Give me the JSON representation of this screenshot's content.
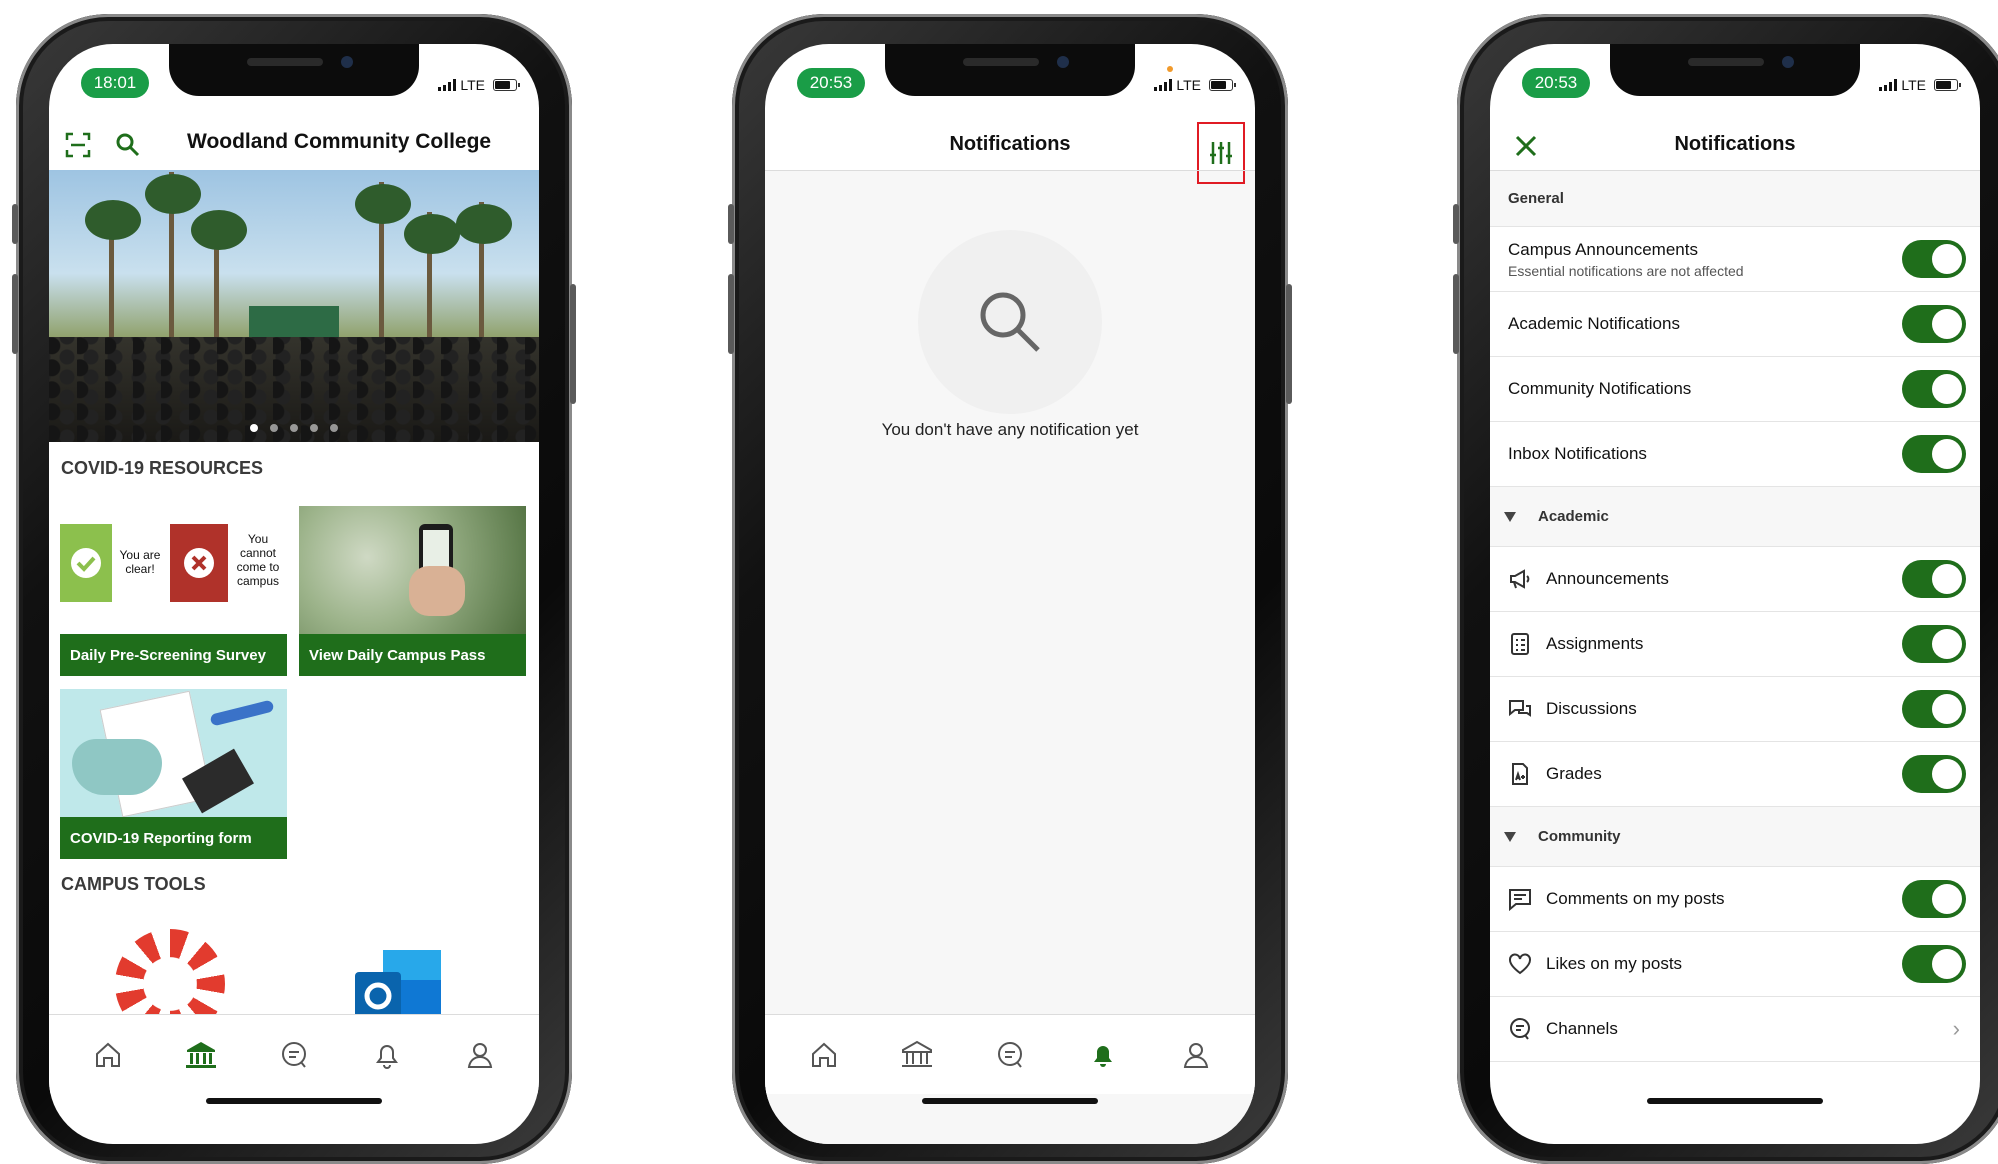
{
  "accent_color": "#1f6e1b",
  "status_color": "#1a9d47",
  "phones": [
    {
      "time": "18:01",
      "network": "LTE",
      "header": {
        "title": "Woodland Community College",
        "icons": [
          "scan-icon",
          "search-icon"
        ]
      },
      "banner": {
        "slides": 5,
        "active_slide": 1
      },
      "sections": {
        "covid_title": "COVID-19 RESOURCES",
        "tools_title": "CAMPUS TOOLS"
      },
      "cards": [
        {
          "label": "Daily Pre-Screening Survey",
          "clear_text": "You are clear!",
          "cannot_text": "You cannot come to campus"
        },
        {
          "label": "View Daily Campus Pass"
        },
        {
          "label": "COVID-19 Reporting form"
        }
      ],
      "tools": [
        "canvas-logo",
        "outlook-logo"
      ],
      "tabs": [
        "home-icon",
        "campus-icon",
        "messages-icon",
        "bell-icon",
        "profile-icon"
      ],
      "active_tab": "campus-icon"
    },
    {
      "time": "20:53",
      "network": "LTE",
      "header": {
        "title": "Notifications"
      },
      "empty_message": "You don't have any notification yet",
      "active_tab": "bell-icon"
    },
    {
      "time": "20:53",
      "network": "LTE",
      "header": {
        "title": "Notifications"
      },
      "general_label": "General",
      "rows_general": [
        {
          "label": "Campus Announcements",
          "sub": "Essential notifications are not affected",
          "on": true
        },
        {
          "label": "Academic Notifications",
          "on": true
        },
        {
          "label": "Community Notifications",
          "on": true
        },
        {
          "label": "Inbox Notifications",
          "on": true
        }
      ],
      "academic_label": "Academic",
      "rows_academic": [
        {
          "label": "Announcements",
          "icon": "megaphone-icon",
          "on": true
        },
        {
          "label": "Assignments",
          "icon": "checklist-icon",
          "on": true
        },
        {
          "label": "Discussions",
          "icon": "chat-bubbles-icon",
          "on": true
        },
        {
          "label": "Grades",
          "icon": "grades-icon",
          "on": true
        }
      ],
      "community_label": "Community",
      "rows_community": [
        {
          "label": "Comments on my posts",
          "icon": "comment-icon",
          "on": true
        },
        {
          "label": "Likes on my posts",
          "icon": "heart-icon",
          "on": true
        },
        {
          "label": "Channels",
          "icon": "channels-icon",
          "chevron": true
        }
      ]
    }
  ]
}
